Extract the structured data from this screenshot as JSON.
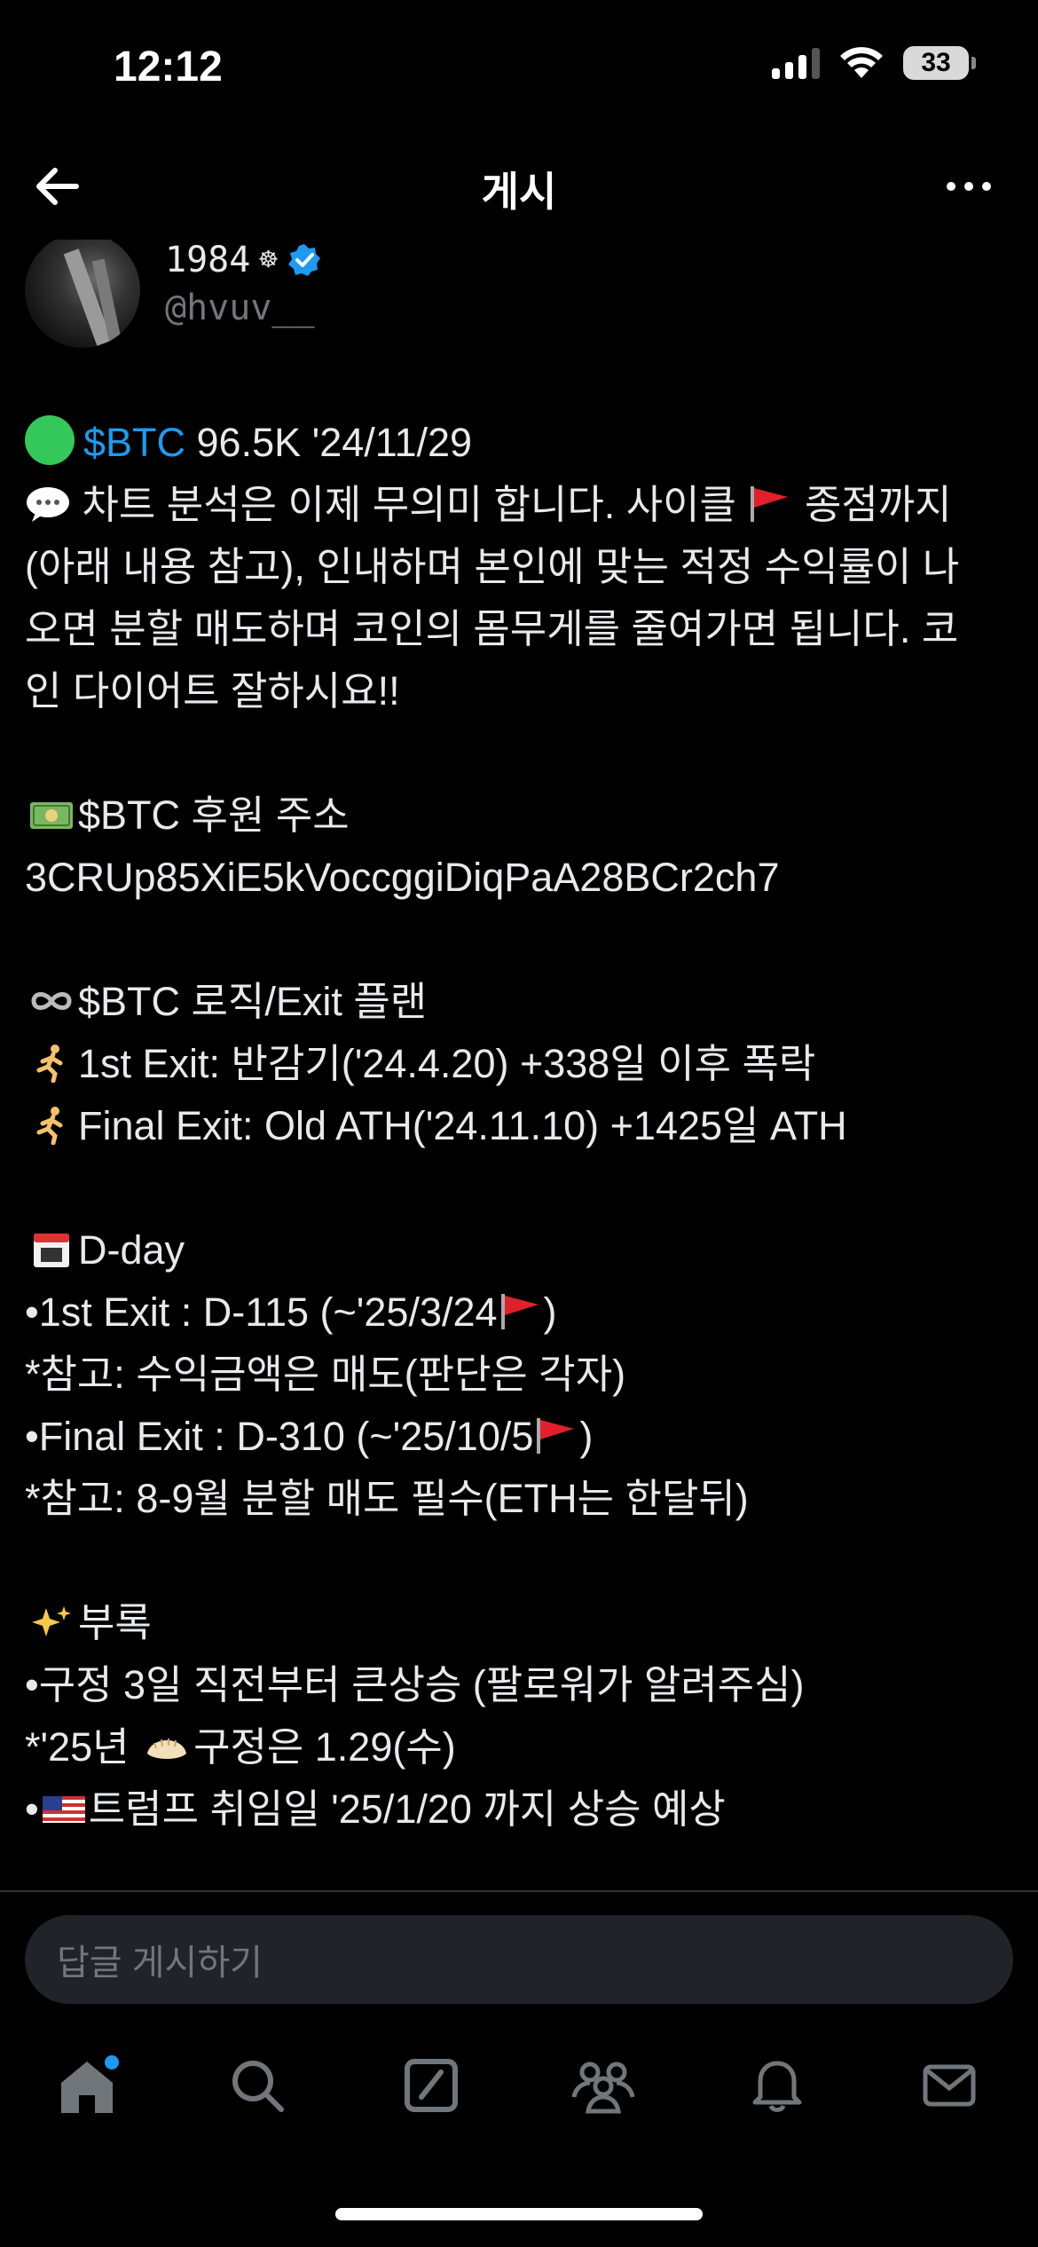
{
  "status_bar": {
    "time": "12:12",
    "battery": "33"
  },
  "nav": {
    "title": "게시"
  },
  "author": {
    "name": "1984",
    "handle": "@hvuv__"
  },
  "tweet": {
    "l1_cashtag": "$BTC",
    "l1_rest": " 96.5K '24/11/29",
    "l2": " 차트 분석은 이제 무의미 합니다. 사이클",
    "l2b": " 종점까지",
    "l3": "(아래 내용 참고), 인내하며 본인에 맞는 적정 수익률이 나",
    "l4": "오면 분할 매도하며 코인의 몸무게를 줄여가면 됩니다. 코",
    "l5": "인 다이어트 잘하시요!!",
    "l7": "$BTC 후원 주소",
    "l8": "3CRUp85XiE5kVoccggiDiqPaA28BCr2ch7",
    "l10": "$BTC 로직/Exit 플랜",
    "l11": "1st Exit: 반감기('24.4.20) +338일 이후 폭락",
    "l12": "Final Exit: Old ATH('24.11.10) +1425일 ATH",
    "l14": "D-day",
    "l15": "•1st Exit : D-115 (~'25/3/24",
    "l15b": ")",
    "l16": "*참고: 수익금액은 매도(판단은 각자)",
    "l17": "•Final Exit : D-310 (~'25/10/5",
    "l17b": ")",
    "l18": "*참고: 8-9월 분할 매도 필수(ETH는 한달뒤)",
    "l20": "부록",
    "l21": "•구정 3일 직전부터 큰상승 (팔로워가 알려주심)",
    "l22a": "*'25년 ",
    "l22b": "구정은 1.29(수)",
    "l23a": "•",
    "l23b": "트럼프 취임일 '25/1/20 까지 상승 예상"
  },
  "reply": {
    "placeholder": "답글 게시하기"
  },
  "colors": {
    "accent": "#1d9bf0",
    "background": "#000000",
    "text": "#e7e9ea",
    "muted": "#71767b"
  },
  "icons": [
    "back-arrow-icon",
    "more-icon",
    "verified-badge-icon",
    "home-icon",
    "search-icon",
    "grok-icon",
    "communities-icon",
    "notifications-icon",
    "messages-icon"
  ]
}
